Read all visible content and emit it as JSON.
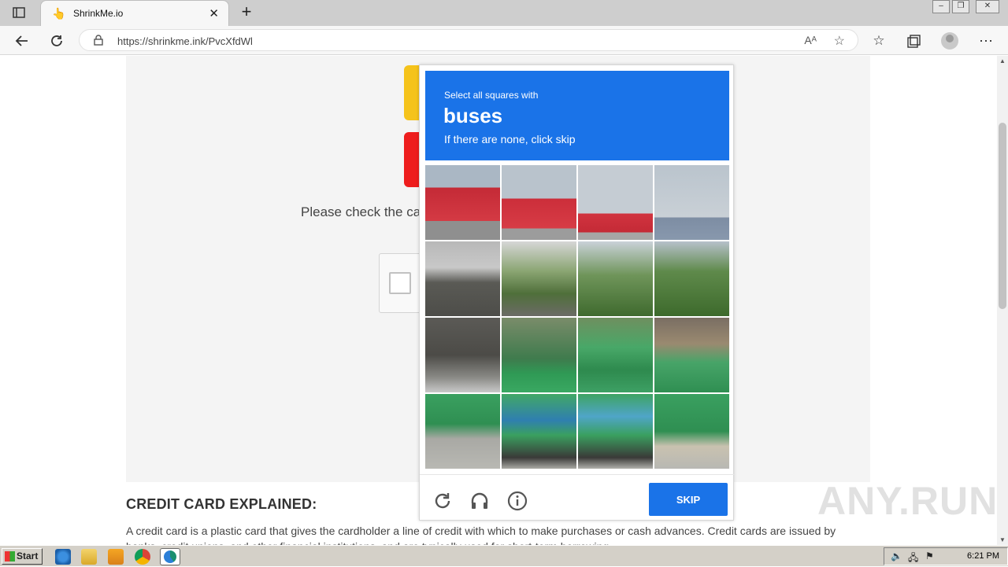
{
  "browser": {
    "tab_title": "ShrinkMe.io",
    "tab_close": "✕",
    "new_tab": "+",
    "url": "https://shrinkme.ink/PvcXfdWl",
    "read_aloud": "Aᴬ"
  },
  "page": {
    "check_text": "Please check the ca",
    "heading": "CREDIT CARD EXPLAINED:",
    "paragraph": "A credit card is a plastic card that gives the cardholder a line of credit with which to make purchases or cash advances. Credit cards are issued by banks, credit unions, and other financial institutions, and are typically used for short-term borrowing."
  },
  "captcha": {
    "instruction": "Select all squares with",
    "target": "buses",
    "hint": "If there are none, click skip",
    "skip_label": "SKIP",
    "accent_color": "#1a73e8",
    "grid_rows": 4,
    "grid_cols": 4
  },
  "watermark": "ANY.RUN",
  "taskbar": {
    "start_label": "Start",
    "clock": "6:21 PM"
  }
}
